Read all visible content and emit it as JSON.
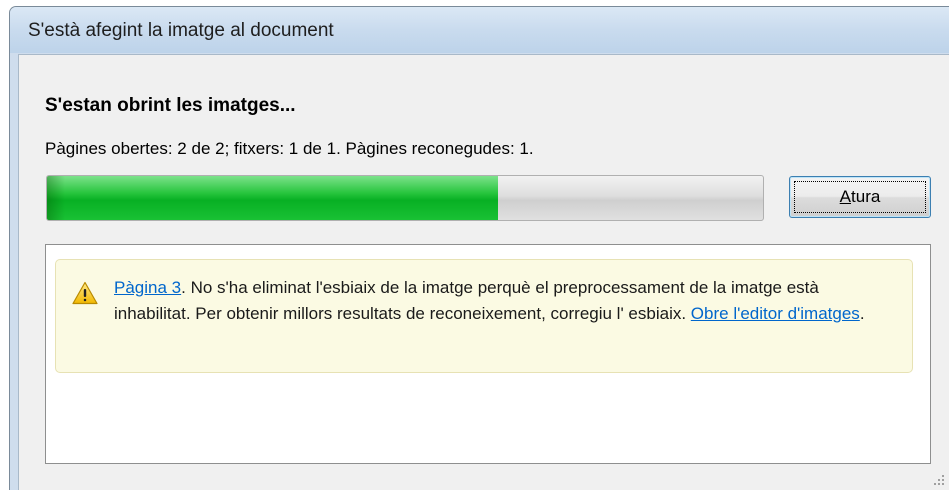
{
  "window": {
    "title": "S'està afegint la imatge al document"
  },
  "dialog": {
    "heading": "S'estan obrint les imatges...",
    "status": "Pàgines obertes: 2 de 2; fitxers: 1 de 1. Pàgines reconegudes: 1.",
    "progress_percent": 63,
    "progress_color": "#14b82e",
    "stop_button": {
      "mnemonic": "A",
      "rest": "tura"
    }
  },
  "messages": [
    {
      "icon": "warning-icon",
      "page_link": "Pàgina 3",
      "text_before": ". No s'ha eliminat l'esbiaix de la imatge perquè el preprocessament de la imatge està inhabilitat. Per obtenir millors resultats de reconeixement, corregiu l' esbiaix. ",
      "editor_link": "Obre l'editor d'imatges",
      "text_after": "."
    }
  ]
}
